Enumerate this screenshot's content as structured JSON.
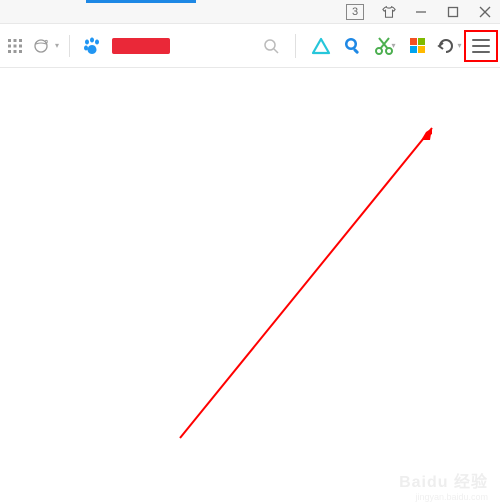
{
  "titlebar": {
    "tab_count": "3"
  },
  "toolbar": {
    "redacted_label": ""
  },
  "watermark": {
    "brand": "Baidu 经验",
    "url": "jingyan.baidu.com"
  },
  "colors": {
    "highlight": "#ff0000",
    "arrow": "#ff0000",
    "accent_blue": "#1e88e5"
  }
}
